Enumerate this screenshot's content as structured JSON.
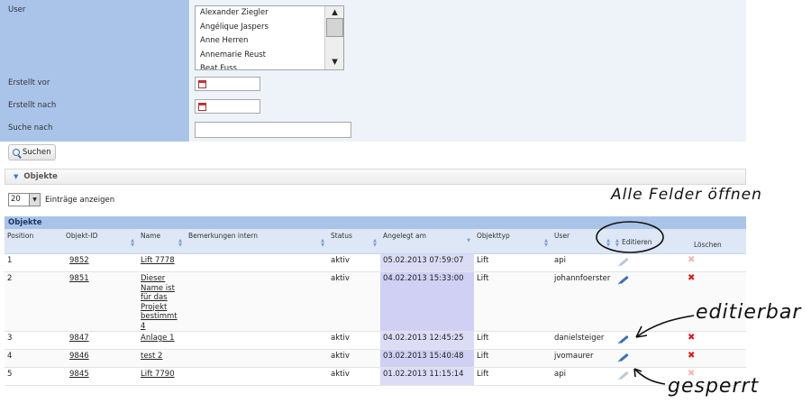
{
  "form": {
    "user_label": "User",
    "users": [
      "Alexander Ziegler",
      "Angélique Jaspers",
      "Anne Herren",
      "Annemarie Reust",
      "Beat Fuss"
    ],
    "created_before_label": "Erstellt vor",
    "created_after_label": "Erstellt nach",
    "search_label": "Suche nach",
    "search_value": "",
    "search_button": "Suchen"
  },
  "section": {
    "title": "Objekte"
  },
  "length": {
    "value": "20",
    "label": "Einträge anzeigen"
  },
  "table": {
    "caption": "Objekte",
    "headers": [
      "Position",
      "Objekt-ID",
      "Name",
      "Bemerkungen intern",
      "Status",
      "Angelegt am",
      "Objekttyp",
      "User",
      "Editieren",
      "Löschen"
    ],
    "rows": [
      {
        "position": "1",
        "id": "9852",
        "name": "Lift 7778",
        "notes": "",
        "status": "aktiv",
        "created": "05.02.2013 07:59:07",
        "type": "Lift",
        "user": "api",
        "editable": false
      },
      {
        "position": "2",
        "id": "9851",
        "name": "Dieser Name ist für das Projekt bestimmt 4",
        "notes": "",
        "status": "aktiv",
        "created": "04.02.2013 15:33:00",
        "type": "Lift",
        "user": "johannfoerster",
        "editable": true
      },
      {
        "position": "3",
        "id": "9847",
        "name": "Anlage 1",
        "notes": "",
        "status": "aktiv",
        "created": "04.02.2013 12:45:25",
        "type": "Lift",
        "user": "danielsteiger",
        "editable": true
      },
      {
        "position": "4",
        "id": "9846",
        "name": "test 2",
        "notes": "",
        "status": "aktiv",
        "created": "03.02.2013 15:40:48",
        "type": "Lift",
        "user": "jvomaurer",
        "editable": true
      },
      {
        "position": "5",
        "id": "9845",
        "name": "Lift 7790",
        "notes": "",
        "status": "aktiv",
        "created": "01.02.2013 11:15:14",
        "type": "Lift",
        "user": "api",
        "editable": false
      }
    ]
  },
  "annotations": {
    "open_all": "Alle Felder öffnen",
    "editable": "editierbar",
    "locked": "gesperrt"
  },
  "colors": {
    "label_bg": "#a9c4e8",
    "value_bg": "#eef3fa",
    "highlight": "#dcdcf6",
    "delete": "#d21e1e",
    "edit": "#3c6fb2"
  },
  "icons": {
    "calendar": "calendar-icon",
    "search": "search-icon",
    "edit": "pencil-icon",
    "delete": "delete-x-icon"
  }
}
